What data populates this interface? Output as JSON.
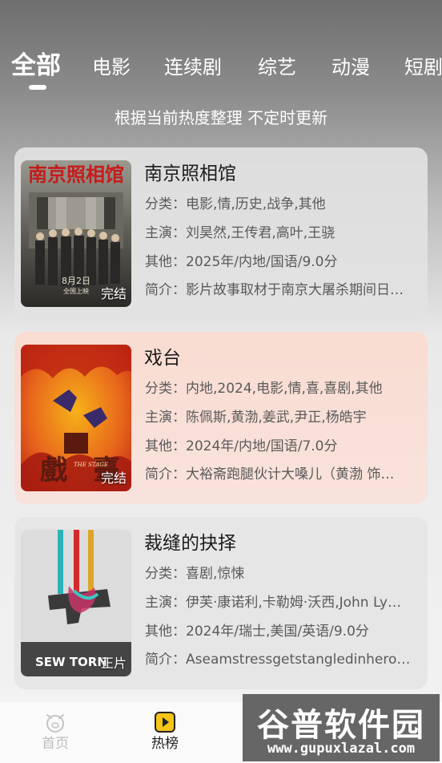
{
  "tabs": [
    {
      "label": "全部",
      "active": true
    },
    {
      "label": "电影"
    },
    {
      "label": "连续剧"
    },
    {
      "label": "综艺"
    },
    {
      "label": "动漫"
    },
    {
      "label": "短剧"
    }
  ],
  "subtitle": "根据当前热度整理 不定时更新",
  "items": [
    {
      "title": "南京照相馆",
      "category": "分类：电影,情,历史,战争,其他",
      "cast": "主演：刘昊然,王传君,高叶,王骁",
      "other": "其他：2025年/内地/国语/9.0分",
      "intro": "简介：影片故事取材于南京大屠杀期间日…",
      "status": "完结",
      "poster_text": "南京照相馆",
      "poster_date": "8月2日",
      "poster_release": "全国上映"
    },
    {
      "title": "戏台",
      "category": "分类：内地,2024,电影,情,喜,喜剧,其他",
      "cast": "主演：陈佩斯,黄渤,姜武,尹正,杨皓宇",
      "other": "其他：2024年/内地/国语/7.0分",
      "intro": "简介：大裕斋跑腿伙计大嗓儿（黄渤 饰…",
      "status": "完结",
      "poster_text_1": "戲",
      "poster_text_2": "臺",
      "poster_en": "THE STAGE"
    },
    {
      "title": "裁缝的抉择",
      "category": "分类：喜剧,惊悚",
      "cast": "主演：伊芙·康诺利,卡勒姆·沃西,John Ly…",
      "other": "其他：2024年/瑞士,美国/英语/9.0分",
      "intro": "简介：Aseamstressgetstangledinherow…",
      "status": "正片",
      "poster_text": "SEW TORN"
    }
  ],
  "bottom_nav": [
    {
      "label": "首页",
      "icon": "pig-face-icon",
      "active": false
    },
    {
      "label": "热榜",
      "icon": "play-square-icon",
      "active": true
    }
  ],
  "watermark": {
    "logo": "谷普软件园",
    "url": "www.gupuxlazal.com"
  },
  "colors": {
    "accent": "#f5c518",
    "card2_bg": "#f9dcd2"
  }
}
